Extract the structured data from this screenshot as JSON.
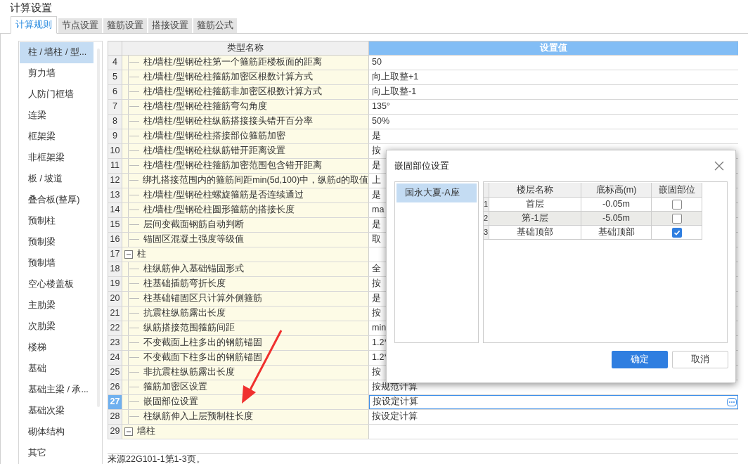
{
  "window": {
    "title": "计算设置"
  },
  "tabs": [
    {
      "label": "计算规则",
      "selected": true
    },
    {
      "label": "节点设置",
      "selected": false
    },
    {
      "label": "箍筋设置",
      "selected": false
    },
    {
      "label": "搭接设置",
      "selected": false
    },
    {
      "label": "箍筋公式",
      "selected": false
    }
  ],
  "sidebar": {
    "items": [
      {
        "label": "柱 / 墙柱 / 型...",
        "selected": true
      },
      {
        "label": "剪力墙",
        "selected": false
      },
      {
        "label": "人防门框墙",
        "selected": false
      },
      {
        "label": "连梁",
        "selected": false
      },
      {
        "label": "框架梁",
        "selected": false
      },
      {
        "label": "非框架梁",
        "selected": false
      },
      {
        "label": "板 / 坡道",
        "selected": false
      },
      {
        "label": "叠合板(整厚)",
        "selected": false
      },
      {
        "label": "预制柱",
        "selected": false
      },
      {
        "label": "预制梁",
        "selected": false
      },
      {
        "label": "预制墙",
        "selected": false
      },
      {
        "label": "空心楼盖板",
        "selected": false
      },
      {
        "label": "主肋梁",
        "selected": false
      },
      {
        "label": "次肋梁",
        "selected": false
      },
      {
        "label": "楼梯",
        "selected": false
      },
      {
        "label": "基础",
        "selected": false
      },
      {
        "label": "基础主梁 / 承...",
        "selected": false
      },
      {
        "label": "基础次梁",
        "selected": false
      },
      {
        "label": "砌体结构",
        "selected": false
      },
      {
        "label": "其它",
        "selected": false
      }
    ]
  },
  "table": {
    "columns": [
      "类型名称",
      "设置值"
    ],
    "rows": [
      {
        "kind": "item",
        "number": "4",
        "name": "柱/墙柱/型钢砼柱第一个箍筋距楼板面的距离",
        "value": "50",
        "selected": false
      },
      {
        "kind": "item",
        "number": "5",
        "name": "柱/墙柱/型钢砼柱箍筋加密区根数计算方式",
        "value": "向上取整+1",
        "selected": false
      },
      {
        "kind": "item",
        "number": "6",
        "name": "柱/墙柱/型钢砼柱箍筋非加密区根数计算方式",
        "value": "向上取整-1",
        "selected": false
      },
      {
        "kind": "item",
        "number": "7",
        "name": "柱/墙柱/型钢砼柱箍筋弯勾角度",
        "value": "135°",
        "selected": false
      },
      {
        "kind": "item",
        "number": "8",
        "name": "柱/墙柱/型钢砼柱纵筋搭接接头错开百分率",
        "value": "50%",
        "selected": false
      },
      {
        "kind": "item",
        "number": "9",
        "name": "柱/墙柱/型钢砼柱搭接部位箍筋加密",
        "value": "是",
        "selected": false
      },
      {
        "kind": "item",
        "number": "10",
        "name": "柱/墙柱/型钢砼柱纵筋错开距离设置",
        "value": "按",
        "selected": false
      },
      {
        "kind": "item",
        "number": "11",
        "name": "柱/墙柱/型钢砼柱箍筋加密范围包含错开距离",
        "value": "是",
        "selected": false
      },
      {
        "kind": "item",
        "number": "12",
        "name": "绑扎搭接范围内的箍筋间距min(5d,100)中，纵筋d的取值",
        "value": "上",
        "selected": false
      },
      {
        "kind": "item",
        "number": "13",
        "name": "柱/墙柱/型钢砼柱螺旋箍筋是否连续通过",
        "value": "是",
        "selected": false
      },
      {
        "kind": "item",
        "number": "14",
        "name": "柱/墙柱/型钢砼柱圆形箍筋的搭接长度",
        "value": "ma",
        "selected": false
      },
      {
        "kind": "item",
        "number": "15",
        "name": "层间变截面钢筋自动判断",
        "value": "是",
        "selected": false
      },
      {
        "kind": "item",
        "number": "16",
        "name": "锚固区混凝土强度等级值",
        "value": "取",
        "selected": false
      },
      {
        "kind": "group",
        "number": "17",
        "name": "柱",
        "expanded": true,
        "selected": false
      },
      {
        "kind": "item",
        "number": "18",
        "name": "柱纵筋伸入基础锚固形式",
        "value": "全",
        "selected": false
      },
      {
        "kind": "item",
        "number": "19",
        "name": "柱基础插筋弯折长度",
        "value": "按",
        "selected": false
      },
      {
        "kind": "item",
        "number": "20",
        "name": "柱基础锚固区只计算外侧箍筋",
        "value": "是",
        "selected": false
      },
      {
        "kind": "item",
        "number": "21",
        "name": "抗震柱纵筋露出长度",
        "value": "按",
        "selected": false
      },
      {
        "kind": "item",
        "number": "22",
        "name": "纵筋搭接范围箍筋间距",
        "value": "min",
        "selected": false
      },
      {
        "kind": "item",
        "number": "23",
        "name": "不变截面上柱多出的钢筋锚固",
        "value": "1.2*",
        "selected": false
      },
      {
        "kind": "item",
        "number": "24",
        "name": "不变截面下柱多出的钢筋锚固",
        "value": "1.2*",
        "selected": false
      },
      {
        "kind": "item",
        "number": "25",
        "name": "非抗震柱纵筋露出长度",
        "value": "按",
        "selected": false
      },
      {
        "kind": "item",
        "number": "26",
        "name": "箍筋加密区设置",
        "value": "按规范计算",
        "selected": false
      },
      {
        "kind": "item",
        "number": "27",
        "name": "嵌固部位设置",
        "value": "按设定计算",
        "selected": true
      },
      {
        "kind": "item",
        "number": "28",
        "name": "柱纵筋伸入上层预制柱长度",
        "value": "按设定计算",
        "selected": false
      },
      {
        "kind": "group",
        "number": "29",
        "name": "墙柱",
        "expanded": true,
        "selected": false
      }
    ]
  },
  "footnote": "来源22G101-1第1-3页。",
  "dialog": {
    "title": "嵌固部位设置",
    "buildings": [
      {
        "label": "国永大夏-A座",
        "selected": true
      }
    ],
    "columns": [
      "楼层名称",
      "底标高(m)",
      "嵌固部位"
    ],
    "rows": [
      {
        "number": "1",
        "floor": "首层",
        "elevation": "-0.05m",
        "checked": false,
        "selected": false
      },
      {
        "number": "2",
        "floor": "第-1层",
        "elevation": "-5.05m",
        "checked": false,
        "selected": true
      },
      {
        "number": "3",
        "floor": "基础顶部",
        "elevation": "基础顶部",
        "checked": true,
        "selected": false
      }
    ],
    "buttons": [
      {
        "label": "确定",
        "kind": "primary"
      },
      {
        "label": "取消",
        "kind": "secondary"
      }
    ]
  }
}
